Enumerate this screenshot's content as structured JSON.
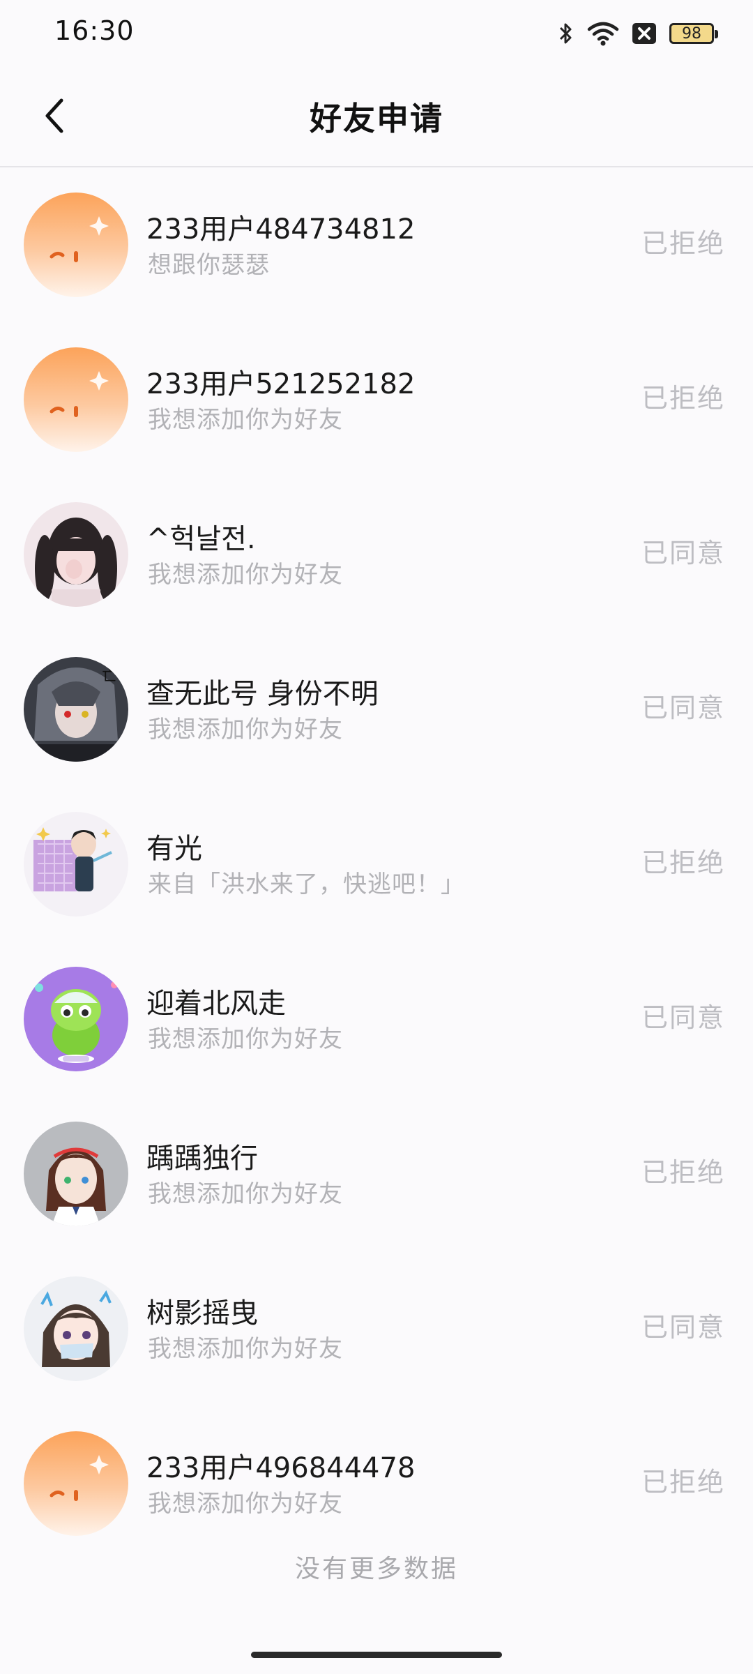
{
  "status_bar": {
    "time": "16:30",
    "battery": "98"
  },
  "header": {
    "title": "好友申请"
  },
  "requests": [
    {
      "name": "233用户484734812",
      "message": "想跟你瑟瑟",
      "status": "已拒绝",
      "avatar": "default"
    },
    {
      "name": "233用户521252182",
      "message": "我想添加你为好友",
      "status": "已拒绝",
      "avatar": "default"
    },
    {
      "name": "^헉날전.",
      "message": "我想添加你为好友",
      "status": "已同意",
      "avatar": "photo-girl"
    },
    {
      "name": "查无此号 身份不明",
      "message": "我想添加你为好友",
      "status": "已同意",
      "avatar": "anime-dark"
    },
    {
      "name": "有光",
      "message": "来自「洪水来了，快逃吧！」",
      "status": "已拒绝",
      "avatar": "anime-boy"
    },
    {
      "name": "迎着北风走",
      "message": "我想添加你为好友",
      "status": "已同意",
      "avatar": "green-character"
    },
    {
      "name": "踽踽独行",
      "message": "我想添加你为好友",
      "status": "已拒绝",
      "avatar": "anime-girl-red"
    },
    {
      "name": "树影摇曳",
      "message": "我想添加你为好友",
      "status": "已同意",
      "avatar": "anime-girl-mask"
    },
    {
      "name": "233用户496844478",
      "message": "我想添加你为好友",
      "status": "已拒绝",
      "avatar": "default"
    }
  ],
  "footer": {
    "no_more": "没有更多数据"
  },
  "icons": {
    "back": "chevron-left-icon",
    "bluetooth": "bluetooth-icon",
    "wifi": "wifi-icon",
    "sim": "no-sim-icon",
    "battery": "battery-icon"
  }
}
